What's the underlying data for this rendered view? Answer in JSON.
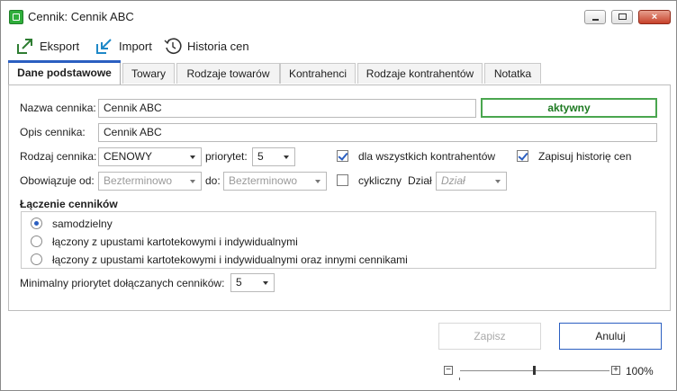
{
  "window": {
    "title": "Cennik: Cennik ABC",
    "close_glyph": "×"
  },
  "toolbar": {
    "items": [
      {
        "label": "Eksport",
        "icon": "export-icon"
      },
      {
        "label": "Import",
        "icon": "import-icon"
      },
      {
        "label": "Historia cen",
        "icon": "history-icon"
      }
    ]
  },
  "tabs": [
    {
      "label": "Dane podstawowe",
      "active": true
    },
    {
      "label": "Towary"
    },
    {
      "label": "Rodzaje towarów"
    },
    {
      "label": "Kontrahenci"
    },
    {
      "label": "Rodzaje kontrahentów"
    },
    {
      "label": "Notatka"
    }
  ],
  "form": {
    "name_label": "Nazwa cennika:",
    "name_value": "Cennik ABC",
    "status_value": "aktywny",
    "status_color": "#4aa64f",
    "desc_label": "Opis cennika:",
    "desc_value": "Cennik ABC",
    "type_label": "Rodzaj cennika:",
    "type_value": "CENOWY",
    "priority_label": "priorytet:",
    "priority_value": "5",
    "all_contractors_label": "dla wszystkich kontrahentów",
    "all_contractors_checked": true,
    "save_history_label": "Zapisuj historię cen",
    "save_history_checked": true,
    "valid_from_label": "Obowiązuje od:",
    "valid_from_value": "Bezterminowo",
    "valid_to_label": "do:",
    "valid_to_value": "Bezterminowo",
    "cyclic_label": "cykliczny",
    "cyclic_checked": false,
    "department_label": "Dział",
    "department_placeholder": "Dział"
  },
  "linking": {
    "section_title": "Łączenie cenników",
    "options": [
      {
        "label": "samodzielny",
        "checked": true
      },
      {
        "label": "łączony z upustami kartotekowymi i indywidualnymi",
        "checked": false
      },
      {
        "label": "łączony z upustami kartotekowymi i indywidualnymi oraz innymi cennikami",
        "checked": false
      }
    ],
    "min_priority_label": "Minimalny priorytet dołączanych cenników:",
    "min_priority_value": "5"
  },
  "footer": {
    "save_label": "Zapisz",
    "cancel_label": "Anuluj",
    "zoom_value": "100%",
    "zoom_minus": "−",
    "zoom_plus": "+"
  },
  "colors": {
    "accent": "#2b5fc1",
    "active_green": "#4aa64f",
    "app_icon": "#2fae3b"
  }
}
